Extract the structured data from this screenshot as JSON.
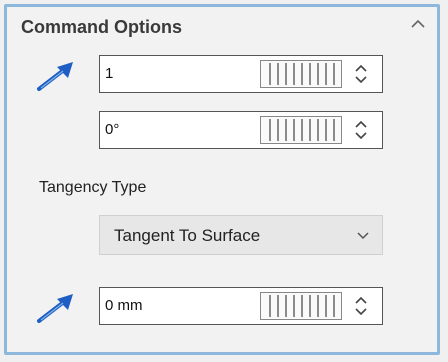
{
  "panel": {
    "title": "Command Options"
  },
  "fields": {
    "distance_1": {
      "value": "1"
    },
    "angle": {
      "value": "0°"
    },
    "distance_2": {
      "value": "0 mm"
    }
  },
  "tangency": {
    "label": "Tangency Type",
    "selected": "Tangent To Surface"
  },
  "icons": {
    "collapse": "chevron-up-icon",
    "arrow": "blue-arrow-icon",
    "thumbwheel": "thumbwheel-icon",
    "spinner": "spinner-icon",
    "dropdown": "chevron-down-icon"
  },
  "colors": {
    "panel_border": "#8db8dc",
    "arrow_blue": "#1f5fc4"
  }
}
